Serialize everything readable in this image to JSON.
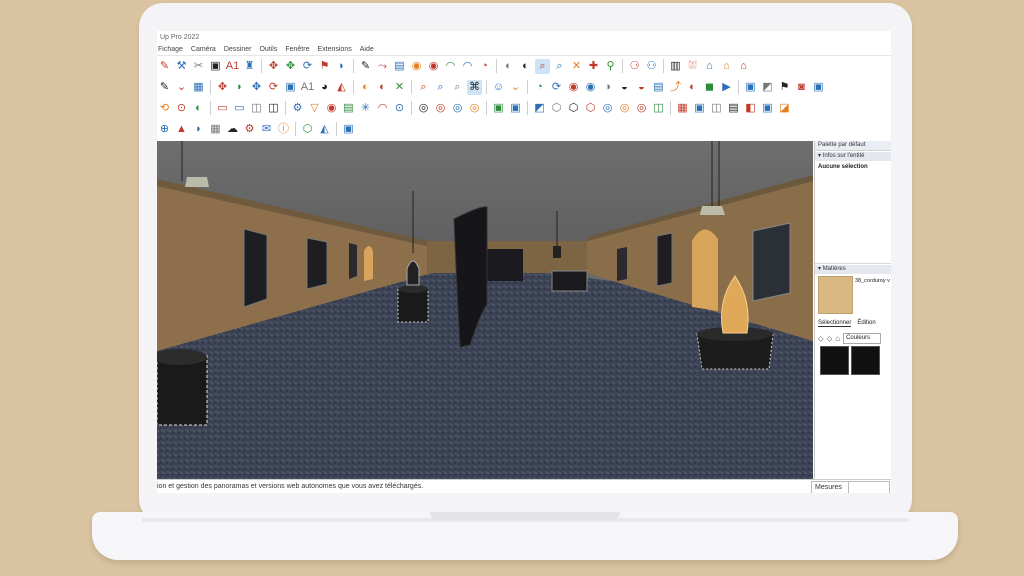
{
  "app": {
    "title": "Up Pro 2022",
    "menu": [
      "Fichage",
      "Caméra",
      "Dessiner",
      "Outils",
      "Fenêtre",
      "Extensions",
      "Aide"
    ]
  },
  "toolbar_rows": [
    [
      "✎",
      "⚒",
      "✂",
      "▣",
      "A1",
      "♜",
      "sep",
      "✥",
      "✥",
      "⟳",
      "⚑",
      "◗",
      "sep",
      "✎",
      "⤳",
      "▤",
      "◉",
      "◉",
      "◠",
      "◠",
      "◔",
      "sep",
      "◐",
      "◐",
      "⌕",
      "⌕",
      "✕",
      "✚",
      "⚲",
      "sep",
      "⚆",
      "⚇",
      "sep",
      "▥",
      "⛆",
      "⌂",
      "⌂",
      "⌂"
    ],
    [
      "✎",
      "⌄",
      "▦",
      "sep",
      "✥",
      "◗",
      "✥",
      "⟳",
      "▣",
      "A1",
      "◕",
      "◭",
      "sep",
      "◐",
      "◐",
      "✕",
      "sep",
      "⌕",
      "⌕",
      "⌕",
      "⌘",
      "sep",
      "☺",
      "⌄",
      "sep",
      "◔",
      "⟳",
      "◉",
      "◉",
      "◑",
      "◒",
      "◒",
      "▤",
      "⤴",
      "◐",
      "◼",
      "▶",
      "sep",
      "▣",
      "◩",
      "⚑",
      "◙",
      "▣"
    ],
    [
      "⟲",
      "⊙",
      "◐",
      "sep",
      "▭",
      "▭",
      "◫",
      "◫",
      "sep",
      "⚙",
      "▽",
      "◉",
      "▤",
      "✳",
      "◠",
      "⊙",
      "sep",
      "◎",
      "◎",
      "◎",
      "◎",
      "sep",
      "▣",
      "▣",
      "sep",
      "◩",
      "⬡",
      "⬡",
      "⬡",
      "◎",
      "◎",
      "◎",
      "◫",
      "sep",
      "▦",
      "▣",
      "◫",
      "▤",
      "◧",
      "▣",
      "◪"
    ],
    [
      "⊕",
      "▲",
      "◗",
      "▦",
      "☁",
      "⚙",
      "✉",
      "ⓘ",
      "sep",
      "⬡",
      "◭",
      "sep",
      "▣"
    ]
  ],
  "status": {
    "message": "ion et gestion des panoramas et versions web autonomes que vous avez téléchargés.",
    "measures_label": "Mesures"
  },
  "panel": {
    "title": "Palette par défaut",
    "entity_header": "Infos sur l'entité",
    "entity_value": "Aucune sélection",
    "materials_header": "Matières",
    "material_name": "38_corduroy v",
    "tab_select": "Sélectionner",
    "tab_edit": "Édition",
    "colors_dropdown": "Couleurs"
  },
  "colors": {
    "background": "#d9c3a0",
    "wall": "#8c6e4a",
    "floor": "#3a4050",
    "sky": "#6b6b6b",
    "material_swatch": "#d9b883"
  }
}
